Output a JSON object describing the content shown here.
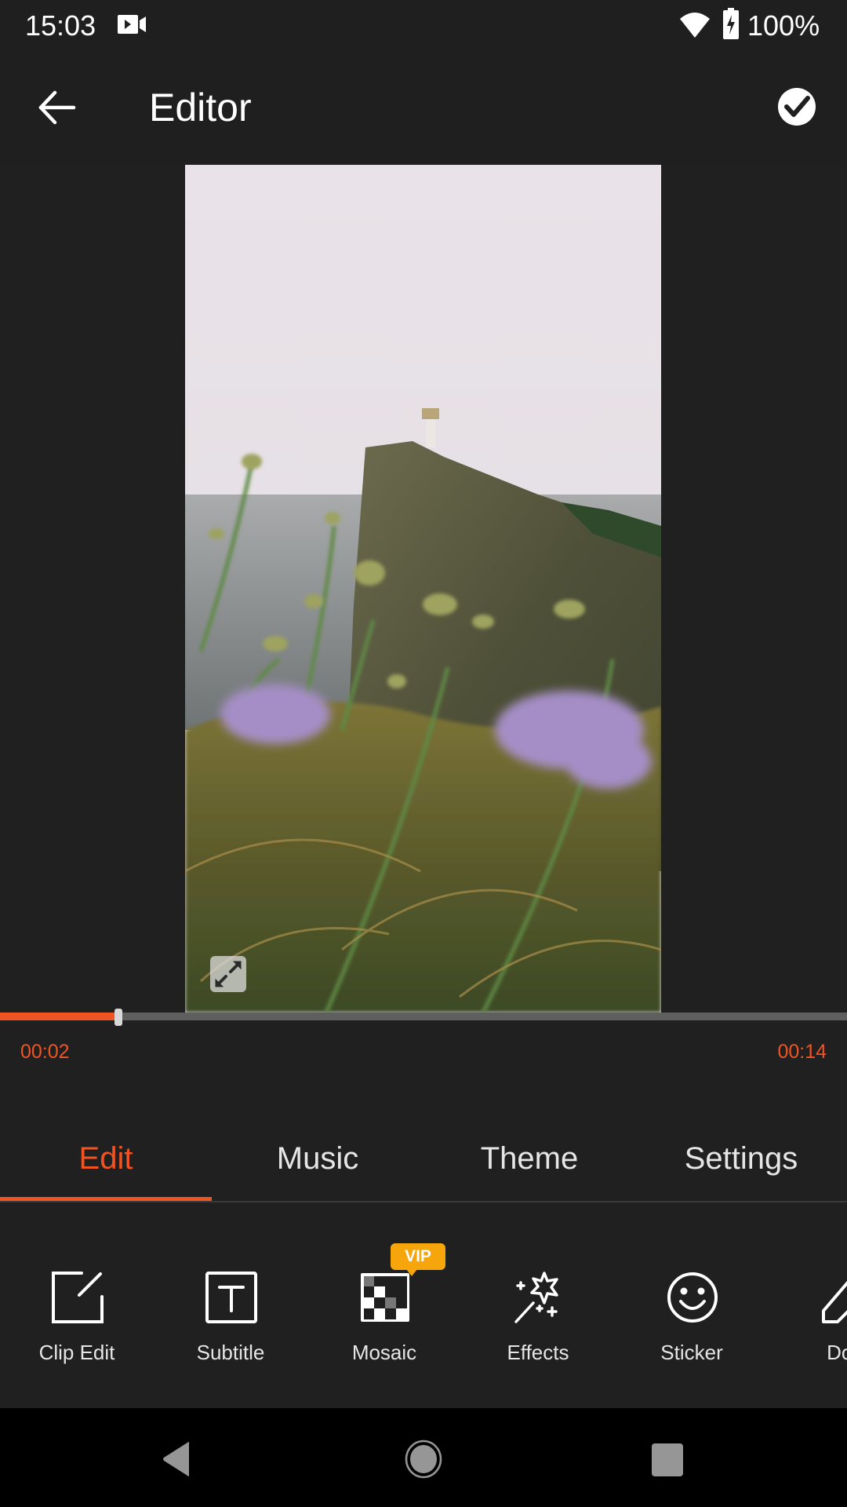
{
  "status_bar": {
    "time": "15:03",
    "notification_icon": "screen-record-icon",
    "wifi_icon": "wifi-icon",
    "battery_icon": "battery-charging-icon",
    "battery_percent": "100%"
  },
  "app_bar": {
    "back_icon": "arrow-left-icon",
    "title": "Editor",
    "confirm_icon": "check-circle-icon"
  },
  "player": {
    "scene": "lighthouse on sea cliff with purple wildflowers",
    "fullscreen_icon": "expand-icon",
    "progress": 0.14,
    "current_time": "00:02",
    "total_time": "00:14"
  },
  "tabs": [
    {
      "label": "Edit",
      "active": true
    },
    {
      "label": "Music",
      "active": false
    },
    {
      "label": "Theme",
      "active": false
    },
    {
      "label": "Settings",
      "active": false
    }
  ],
  "tools": [
    {
      "label": "Clip Edit",
      "icon": "clip-edit-icon"
    },
    {
      "label": "Subtitle",
      "icon": "text-box-icon"
    },
    {
      "label": "Mosaic",
      "icon": "mosaic-icon",
      "badge": "VIP"
    },
    {
      "label": "Effects",
      "icon": "magic-wand-icon"
    },
    {
      "label": "Sticker",
      "icon": "smiley-icon"
    },
    {
      "label": "Doo",
      "icon": "pencil-icon"
    }
  ],
  "nav_bar": {
    "back": "nav-back-icon",
    "home": "nav-home-icon",
    "recents": "nav-recents-icon"
  },
  "colors": {
    "accent": "#f05423",
    "vip": "#f6a50b",
    "background": "#202020",
    "track": "#5f5f5f"
  }
}
